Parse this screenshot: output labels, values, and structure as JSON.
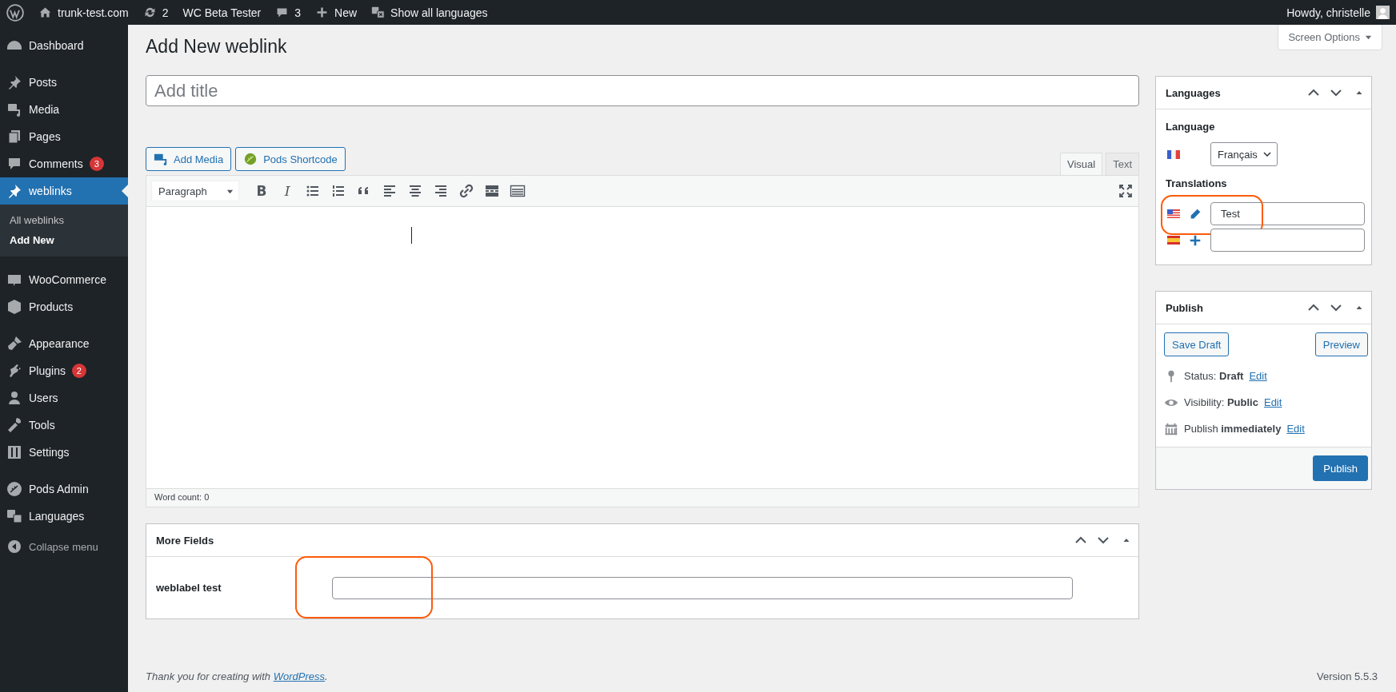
{
  "admin_bar": {
    "site": "trunk-test.com",
    "updates": "2",
    "wc": "WC Beta Tester",
    "comments": "3",
    "new": "New",
    "languages": "Show all languages",
    "greeting": "Howdy, christelle"
  },
  "sidebar": {
    "sections": [
      [
        {
          "label": "Dashboard",
          "selected": false
        }
      ],
      [
        {
          "label": "Posts",
          "selected": false
        },
        {
          "label": "Media",
          "selected": false
        },
        {
          "label": "Pages",
          "selected": false
        },
        {
          "label": "Comments",
          "badge": "3",
          "selected": false
        },
        {
          "label": "weblinks",
          "selected": true,
          "children": [
            {
              "label": "All weblinks",
              "selected": false
            },
            {
              "label": "Add New",
              "selected": true
            }
          ]
        }
      ],
      [
        {
          "label": "WooCommerce",
          "selected": false
        },
        {
          "label": "Products",
          "selected": false
        }
      ],
      [
        {
          "label": "Appearance",
          "selected": false
        },
        {
          "label": "Plugins",
          "badge": "2",
          "selected": false
        },
        {
          "label": "Users",
          "selected": false
        },
        {
          "label": "Tools",
          "selected": false
        },
        {
          "label": "Settings",
          "selected": false
        }
      ],
      [
        {
          "label": "Pods Admin",
          "selected": false
        },
        {
          "label": "Languages",
          "selected": false
        }
      ]
    ],
    "collapse": "Collapse menu"
  },
  "screen_options": "Screen Options",
  "page_title": "Add New weblink",
  "title_field": {
    "placeholder": "Add title"
  },
  "media_buttons": [
    "Add Media",
    "Pods Shortcode"
  ],
  "editor_tabs": [
    {
      "label": "Visual",
      "selected": true
    },
    {
      "label": "Text",
      "selected": false
    }
  ],
  "editor": {
    "format": "Paragraph",
    "toolbar": [
      {
        "kind": "bold",
        "label": "B"
      },
      {
        "kind": "italic",
        "label": "I"
      },
      {
        "kind": "bullets"
      },
      {
        "kind": "numbers"
      },
      {
        "kind": "quote"
      },
      {
        "kind": "align-left"
      },
      {
        "kind": "align-center"
      },
      {
        "kind": "align-right"
      },
      {
        "kind": "link"
      },
      {
        "kind": "more"
      },
      {
        "kind": "toolbar-toggle"
      }
    ],
    "word_count": "Word count: 0"
  },
  "more_fields": {
    "title": "More Fields",
    "fields": [
      {
        "label": "weblabel test",
        "highlighted": true
      }
    ]
  },
  "languages_box": {
    "title": "Languages",
    "language_label": "Language",
    "language": "Français",
    "translations_label": "Translations",
    "translations": [
      {
        "kind": "edit",
        "value": "Test",
        "highlighted": true
      },
      {
        "kind": "add",
        "highlighted": false
      }
    ]
  },
  "publish_box": {
    "title": "Publish",
    "save_draft": "Save Draft",
    "preview": "Preview",
    "rows": [
      {
        "text": "Status: **Draft**",
        "link": "Edit"
      },
      {
        "text": "Visibility: **Public**",
        "link": "Edit"
      },
      {
        "text": "Publish **immediately**",
        "link": "Edit"
      }
    ],
    "publish": "Publish"
  },
  "footer": {
    "thanks": "Thank you for creating with",
    "link": "WordPress",
    "after": ".",
    "version": "Version 5.5.3"
  }
}
